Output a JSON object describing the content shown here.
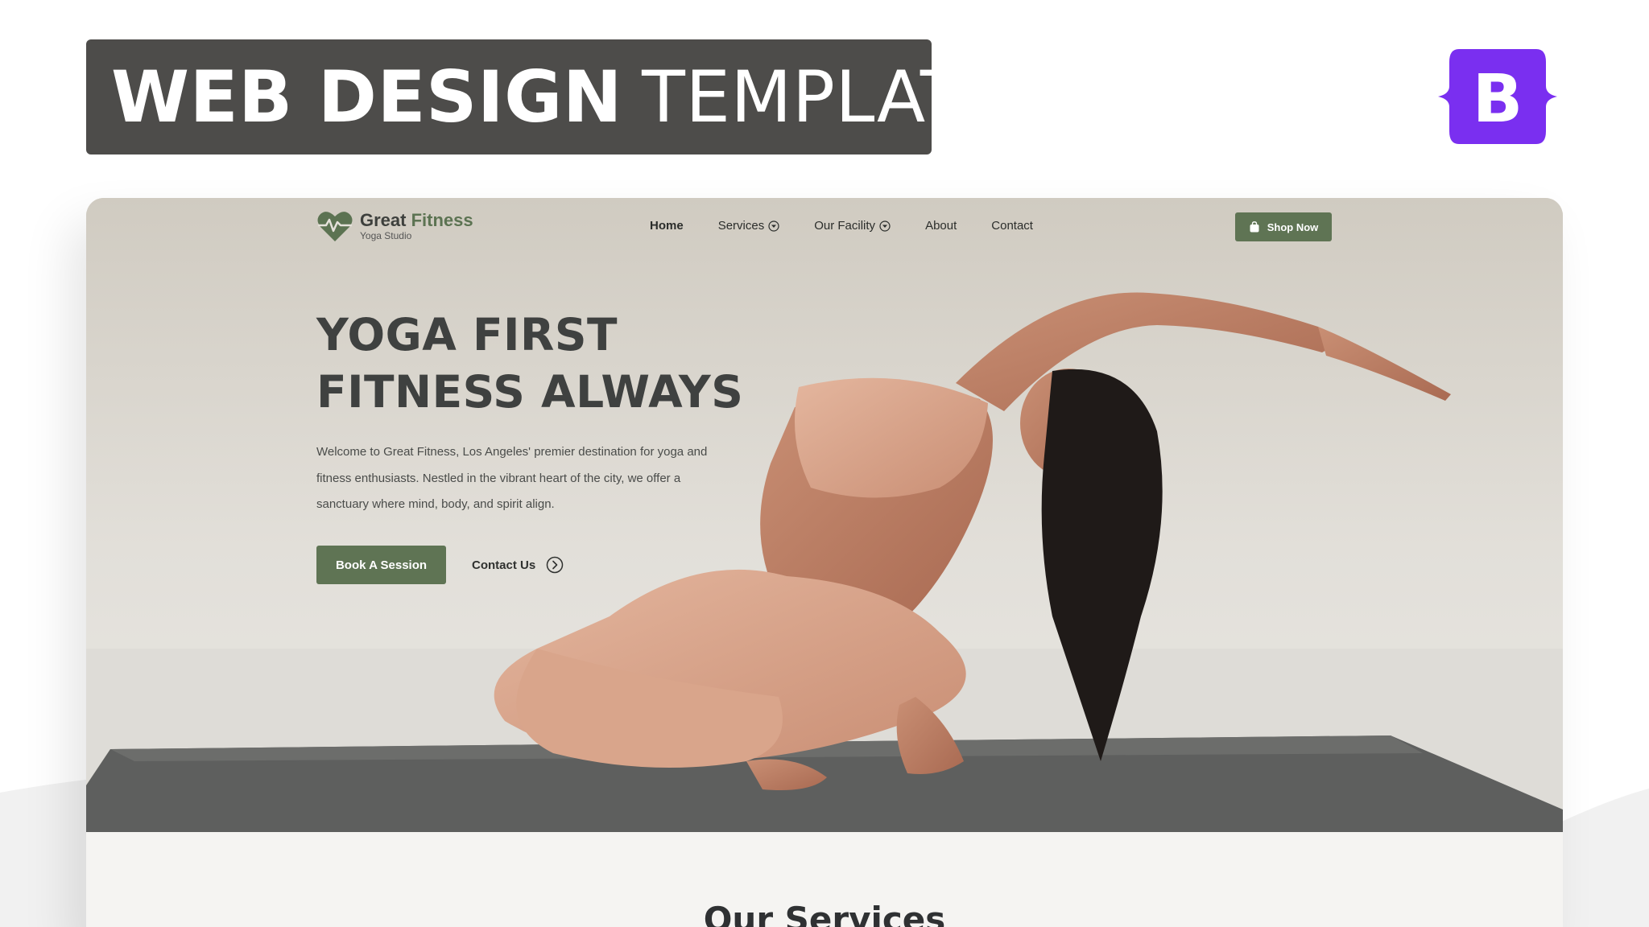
{
  "banner": {
    "title_bold": "WEB DESIGN",
    "title_light": "TEMPLATE",
    "brand_letter": "B",
    "brand_color": "#7a2ff0",
    "background_color": "#4d4c4a"
  },
  "site": {
    "logo": {
      "name_part1": "Great",
      "name_part2": "Fitness",
      "tagline": "Yoga Studio",
      "icon": "heart-pulse-icon"
    },
    "nav": {
      "items": [
        {
          "label": "Home",
          "active": true,
          "dropdown": false
        },
        {
          "label": "Services",
          "active": false,
          "dropdown": true
        },
        {
          "label": "Our Facility",
          "active": false,
          "dropdown": true
        },
        {
          "label": "About",
          "active": false,
          "dropdown": false
        },
        {
          "label": "Contact",
          "active": false,
          "dropdown": false
        }
      ],
      "shop_button": "Shop Now",
      "shop_icon": "shopping-bag-icon"
    },
    "hero": {
      "heading_line1": "YOGA FIRST",
      "heading_line2": "FITNESS ALWAYS",
      "description": "Welcome to Great Fitness, Los Angeles' premier destination for yoga and fitness enthusiasts. Nestled in the vibrant heart of the city, we offer a sanctuary where mind, body, and spirit align.",
      "primary_button": "Book A Session",
      "secondary_link": "Contact Us",
      "secondary_icon": "arrow-circle-right-icon"
    },
    "services": {
      "heading": "Our Services"
    },
    "colors": {
      "accent_green": "#5f7454",
      "heading_gray": "#3f4140"
    }
  }
}
